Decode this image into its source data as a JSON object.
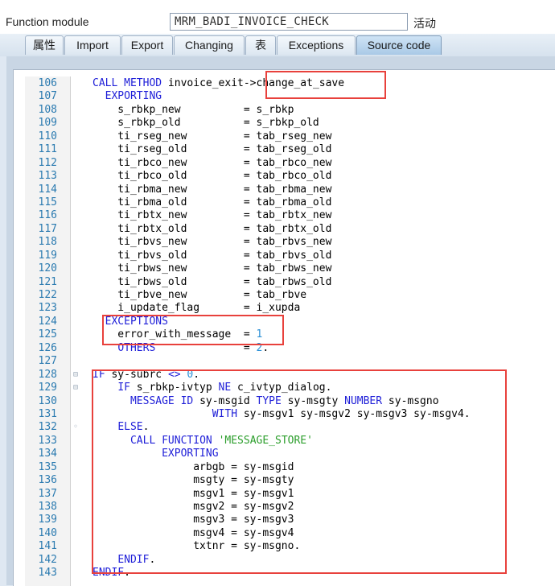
{
  "header": {
    "function_module_label": "Function module",
    "function_module_value": "MRM_BADI_INVOICE_CHECK",
    "status": "活动"
  },
  "tabs": [
    {
      "label": "属性"
    },
    {
      "label": "Import"
    },
    {
      "label": "Export"
    },
    {
      "label": "Changing"
    },
    {
      "label": "表"
    },
    {
      "label": "Exceptions"
    },
    {
      "label": "Source code",
      "active": true
    }
  ],
  "code": [
    {
      "num": "106",
      "fold": "",
      "text": "CALL METHOD invoice_exit->change_at_save"
    },
    {
      "num": "107",
      "fold": "",
      "text": "  EXPORTING"
    },
    {
      "num": "108",
      "fold": "",
      "text": "    s_rbkp_new          = s_rbkp"
    },
    {
      "num": "109",
      "fold": "",
      "text": "    s_rbkp_old          = s_rbkp_old"
    },
    {
      "num": "110",
      "fold": "",
      "text": "    ti_rseg_new         = tab_rseg_new"
    },
    {
      "num": "111",
      "fold": "",
      "text": "    ti_rseg_old         = tab_rseg_old"
    },
    {
      "num": "112",
      "fold": "",
      "text": "    ti_rbco_new         = tab_rbco_new"
    },
    {
      "num": "113",
      "fold": "",
      "text": "    ti_rbco_old         = tab_rbco_old"
    },
    {
      "num": "114",
      "fold": "",
      "text": "    ti_rbma_new         = tab_rbma_new"
    },
    {
      "num": "115",
      "fold": "",
      "text": "    ti_rbma_old         = tab_rbma_old"
    },
    {
      "num": "116",
      "fold": "",
      "text": "    ti_rbtx_new         = tab_rbtx_new"
    },
    {
      "num": "117",
      "fold": "",
      "text": "    ti_rbtx_old         = tab_rbtx_old"
    },
    {
      "num": "118",
      "fold": "",
      "text": "    ti_rbvs_new         = tab_rbvs_new"
    },
    {
      "num": "119",
      "fold": "",
      "text": "    ti_rbvs_old         = tab_rbvs_old"
    },
    {
      "num": "120",
      "fold": "",
      "text": "    ti_rbws_new         = tab_rbws_new"
    },
    {
      "num": "121",
      "fold": "",
      "text": "    ti_rbws_old         = tab_rbws_old"
    },
    {
      "num": "122",
      "fold": "",
      "text": "    ti_rbve_new         = tab_rbve"
    },
    {
      "num": "123",
      "fold": "",
      "text": "    i_update_flag       = i_xupda"
    },
    {
      "num": "124",
      "fold": "",
      "text": "  EXCEPTIONS"
    },
    {
      "num": "125",
      "fold": "",
      "text": "    error_with_message  = 1"
    },
    {
      "num": "126",
      "fold": "",
      "text": "    OTHERS              = 2."
    },
    {
      "num": "127",
      "fold": "",
      "text": ""
    },
    {
      "num": "128",
      "fold": "⊟",
      "text": "IF sy-subrc <> 0."
    },
    {
      "num": "129",
      "fold": "⊟",
      "text": "    IF s_rbkp-ivtyp NE c_ivtyp_dialog."
    },
    {
      "num": "130",
      "fold": "",
      "text": "      MESSAGE ID sy-msgid TYPE sy-msgty NUMBER sy-msgno"
    },
    {
      "num": "131",
      "fold": "",
      "text": "                   WITH sy-msgv1 sy-msgv2 sy-msgv3 sy-msgv4."
    },
    {
      "num": "132",
      "fold": "◦",
      "text": "    ELSE."
    },
    {
      "num": "133",
      "fold": "",
      "text": "      CALL FUNCTION 'MESSAGE_STORE'"
    },
    {
      "num": "134",
      "fold": "",
      "text": "           EXPORTING"
    },
    {
      "num": "135",
      "fold": "",
      "text": "                arbgb = sy-msgid"
    },
    {
      "num": "136",
      "fold": "",
      "text": "                msgty = sy-msgty"
    },
    {
      "num": "137",
      "fold": "",
      "text": "                msgv1 = sy-msgv1"
    },
    {
      "num": "138",
      "fold": "",
      "text": "                msgv2 = sy-msgv2"
    },
    {
      "num": "139",
      "fold": "",
      "text": "                msgv3 = sy-msgv3"
    },
    {
      "num": "140",
      "fold": "",
      "text": "                msgv4 = sy-msgv4"
    },
    {
      "num": "141",
      "fold": "",
      "text": "                txtnr = sy-msgno."
    },
    {
      "num": "142",
      "fold": "",
      "text": "    ENDIF."
    },
    {
      "num": "143",
      "fold": "",
      "text": "ENDIF."
    }
  ],
  "colors": {
    "keyword": "#1f1fd8",
    "number": "#2a8fd6",
    "string": "#2c9e2c",
    "line_number": "#2a7ab0",
    "highlight_box": "#e8413c"
  }
}
